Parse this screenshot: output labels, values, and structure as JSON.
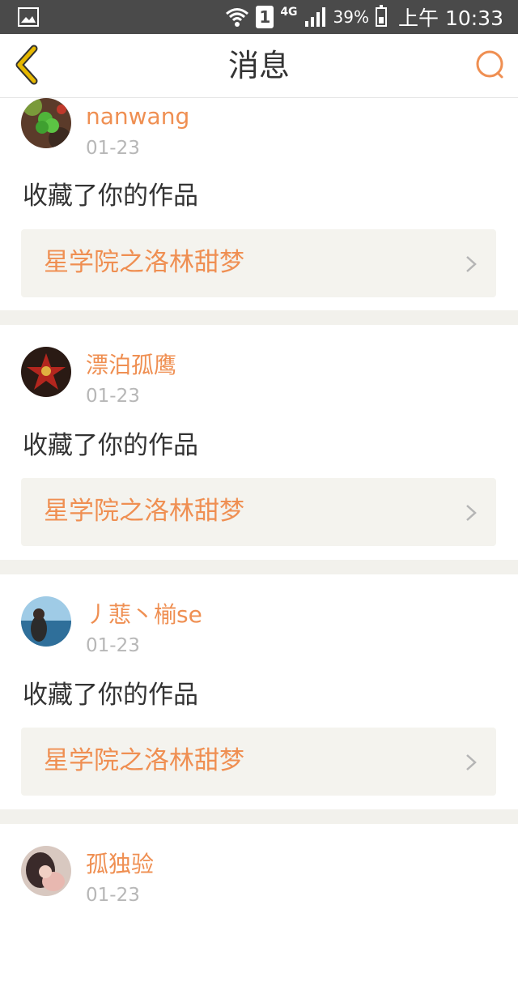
{
  "status_bar": {
    "network": "4G",
    "sim": "1",
    "battery": "39%",
    "time": "上午 10:33"
  },
  "header": {
    "title": "消息",
    "back_icon": "chevron-left-icon",
    "search_icon": "search-icon"
  },
  "colors": {
    "accent": "#ef8f52",
    "back_icon": "#e6b800",
    "background": "#f2f1ec",
    "card_link_bg": "#f4f3ee"
  },
  "messages": [
    {
      "username": "nanwang",
      "date": "01-23",
      "action": "收藏了你的作品",
      "work_title": "星学院之洛林甜梦"
    },
    {
      "username": "漂泊孤鹰",
      "date": "01-23",
      "action": "收藏了你的作品",
      "work_title": "星学院之洛林甜梦"
    },
    {
      "username": "丿蕜丶椾se",
      "date": "01-23",
      "action": "收藏了你的作品",
      "work_title": "星学院之洛林甜梦"
    },
    {
      "username": "孤独验",
      "date": "01-23"
    }
  ]
}
